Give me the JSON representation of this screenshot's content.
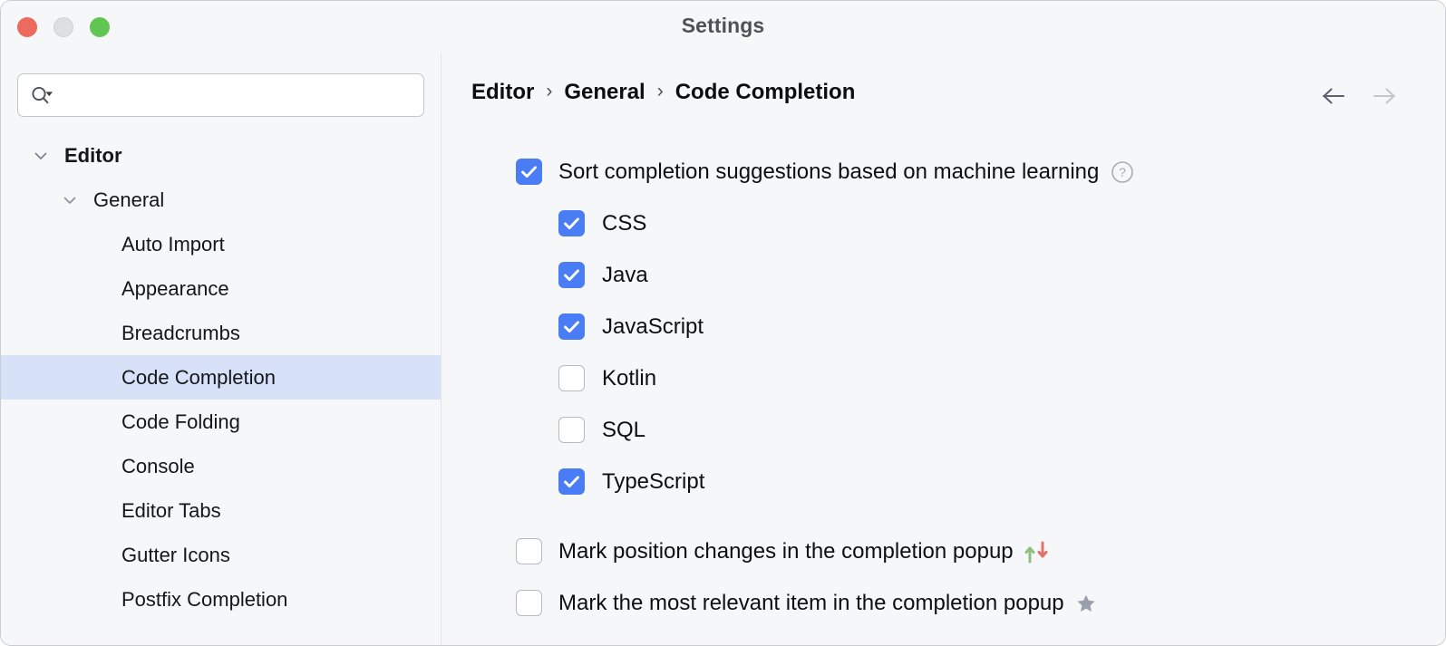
{
  "window": {
    "title": "Settings",
    "traffic_lights": [
      {
        "name": "close",
        "color": "#ec6a5e"
      },
      {
        "name": "minimize",
        "color": "#dedfe1"
      },
      {
        "name": "zoom",
        "color": "#61c554"
      }
    ]
  },
  "sidebar": {
    "search": {
      "value": "",
      "placeholder": "",
      "icon": "search-icon"
    },
    "tree": [
      {
        "label": "Editor",
        "level": 0,
        "chevron": "chevron-down-icon",
        "selected": false
      },
      {
        "label": "General",
        "level": 1,
        "chevron": "chevron-down-icon",
        "selected": false
      },
      {
        "label": "Auto Import",
        "level": 2,
        "chevron": "",
        "selected": false
      },
      {
        "label": "Appearance",
        "level": 2,
        "chevron": "",
        "selected": false
      },
      {
        "label": "Breadcrumbs",
        "level": 2,
        "chevron": "",
        "selected": false
      },
      {
        "label": "Code Completion",
        "level": 2,
        "chevron": "",
        "selected": true
      },
      {
        "label": "Code Folding",
        "level": 2,
        "chevron": "",
        "selected": false
      },
      {
        "label": "Console",
        "level": 2,
        "chevron": "",
        "selected": false
      },
      {
        "label": "Editor Tabs",
        "level": 2,
        "chevron": "",
        "selected": false
      },
      {
        "label": "Gutter Icons",
        "level": 2,
        "chevron": "",
        "selected": false
      },
      {
        "label": "Postfix Completion",
        "level": 2,
        "chevron": "",
        "selected": false
      }
    ]
  },
  "detail": {
    "breadcrumb": {
      "separator": "›",
      "crumbs": [
        "Editor",
        "General",
        "Code Completion"
      ]
    },
    "navigation": {
      "back": {
        "name": "arrow-left-icon",
        "enabled": true,
        "color": "#5c6070"
      },
      "forward": {
        "name": "arrow-right-icon",
        "enabled": false,
        "color": "#c3c6cd"
      }
    },
    "options": [
      {
        "label": "Sort completion suggestions based on machine learning",
        "checked": true,
        "indent": "parent",
        "trailing_icon": "help-circle-icon"
      },
      {
        "label": "CSS",
        "checked": true,
        "indent": "child",
        "trailing_icon": ""
      },
      {
        "label": "Java",
        "checked": true,
        "indent": "child",
        "trailing_icon": ""
      },
      {
        "label": "JavaScript",
        "checked": true,
        "indent": "child",
        "trailing_icon": ""
      },
      {
        "label": "Kotlin",
        "checked": false,
        "indent": "child",
        "trailing_icon": ""
      },
      {
        "label": "SQL",
        "checked": false,
        "indent": "child",
        "trailing_icon": ""
      },
      {
        "label": "TypeScript",
        "checked": true,
        "indent": "child",
        "trailing_icon": ""
      },
      {
        "label": "Mark position changes in the completion popup",
        "checked": false,
        "indent": "parent",
        "trailing_icon": "up-down-arrows-icon"
      },
      {
        "label": "Mark the most relevant item in the completion popup",
        "checked": false,
        "indent": "parent",
        "trailing_icon": "star-icon"
      }
    ]
  },
  "colors": {
    "checkbox_checked": "#4a7cf5",
    "selection_row": "#d7e1f8",
    "arrow_up": "#8dc07f",
    "arrow_down": "#e0736c",
    "star": "#9aa0ab",
    "panel_bg": "#f6f7f9"
  }
}
